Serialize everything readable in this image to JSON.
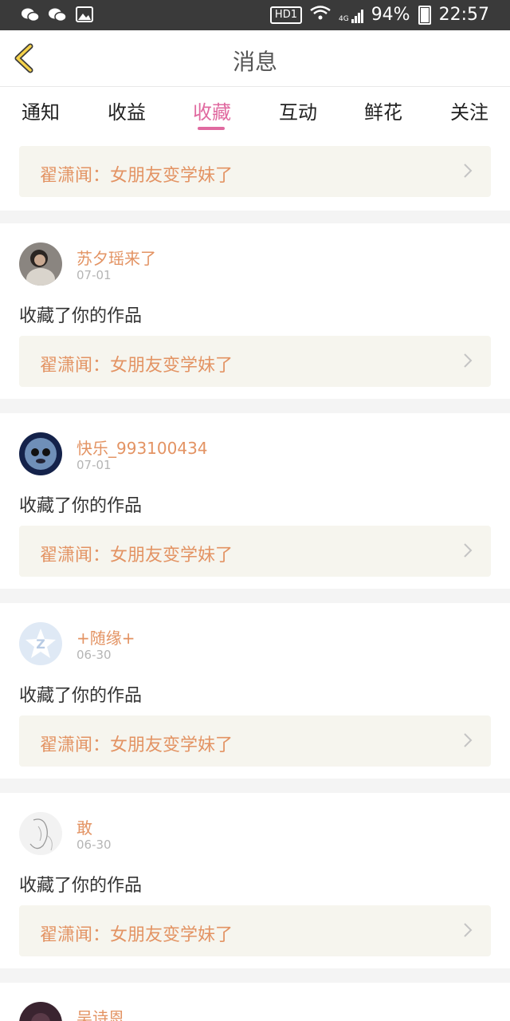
{
  "status_bar": {
    "hd": "HD1",
    "network": "4G",
    "battery": "94%",
    "time": "22:57"
  },
  "header": {
    "title": "消息"
  },
  "tabs": [
    {
      "label": "通知"
    },
    {
      "label": "收益"
    },
    {
      "label": "收藏",
      "active": true
    },
    {
      "label": "互动"
    },
    {
      "label": "鲜花"
    },
    {
      "label": "关注"
    }
  ],
  "top_work": "翟潇闻：女朋友变学妹了",
  "items": [
    {
      "username": "苏夕瑶来了",
      "date": "07-01",
      "action": "收藏了你的作品",
      "work": "翟潇闻：女朋友变学妹了"
    },
    {
      "username": "快乐_993100434",
      "date": "07-01",
      "action": "收藏了你的作品",
      "work": "翟潇闻：女朋友变学妹了"
    },
    {
      "username": "+随缘+",
      "date": "06-30",
      "action": "收藏了你的作品",
      "work": "翟潇闻：女朋友变学妹了"
    },
    {
      "username": "敢",
      "date": "06-30",
      "action": "收藏了你的作品",
      "work": "翟潇闻：女朋友变学妹了"
    },
    {
      "username": "吴诗恩"
    }
  ],
  "colors": {
    "accent": "#e06aa0",
    "orange_text": "#e39363",
    "card_bg": "#f6f5ee"
  }
}
